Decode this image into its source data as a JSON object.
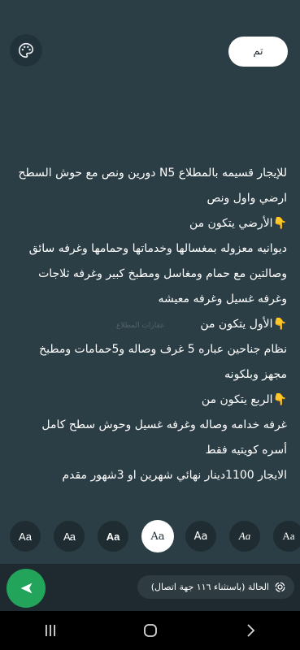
{
  "header": {
    "done_label": "تم",
    "palette_icon": "palette-icon"
  },
  "story_lines": [
    "للإيجار قسيمه بالمطلاع N5 دورين ونص مع حوش السطح",
    "ارضي واول ونص",
    "👇الأرضي يتكون من",
    "ديوانيه معزوله بمغسالها وخدماتها وحمامها وغرفه سائق",
    "وصالتين مع حمام ومغاسل ومطبخ كبير وغرفه ثلاجات",
    "وغرفه غسيل وغرفه معيشه",
    "👇الأول يتكون من",
    "نظام جناحين عباره 5 غرف وصاله و5حمامات ومطبخ",
    "مجهز وبلكونه",
    "👇الربع يتكون من",
    "غرفه خدامه وصاله وغرفه غسيل وحوش سطح كامل",
    "أسره كويتيه فقط",
    "الايجار 1100دينار نهائي شهرين او 3شهور مقدم"
  ],
  "watermark": "عقارات المطلاع",
  "font_options": [
    {
      "label": "Aa",
      "style": "regular"
    },
    {
      "label": "Aa",
      "style": "condensed"
    },
    {
      "label": "Aa",
      "style": "bold"
    },
    {
      "label": "Aa",
      "style": "serif",
      "selected": true
    },
    {
      "label": "Aa",
      "style": "light"
    },
    {
      "label": "Aa",
      "style": "italic"
    },
    {
      "label": "Aa",
      "style": "serif-alt"
    }
  ],
  "status_chip": {
    "label": "الحالة (باستثناء ١١٦ جهة اتصال)",
    "icon": "status-ring-icon"
  },
  "send_icon": "send-icon",
  "nav": {
    "recents_icon": "recents-icon",
    "home_icon": "home-icon",
    "back_icon": "back-icon"
  },
  "colors": {
    "background": "#2c3e45",
    "send_button": "#22a55a",
    "done_button": "#ffffff"
  }
}
